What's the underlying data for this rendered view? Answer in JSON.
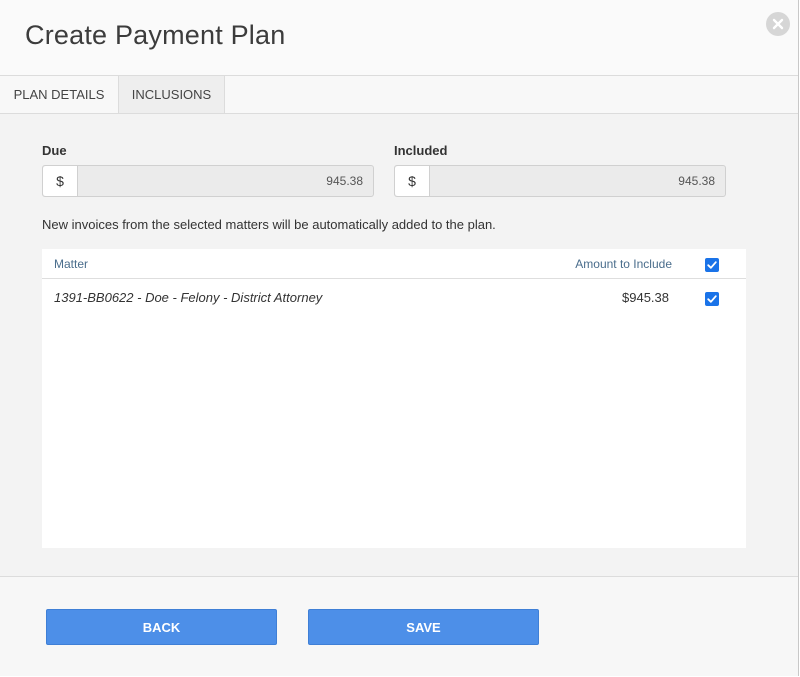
{
  "dialog": {
    "title": "Create Payment Plan"
  },
  "tabs": [
    {
      "label": "PLAN DETAILS",
      "active": false
    },
    {
      "label": "INCLUSIONS",
      "active": true
    }
  ],
  "due": {
    "label": "Due",
    "currency": "$",
    "value": "945.38"
  },
  "included": {
    "label": "Included",
    "currency": "$",
    "value": "945.38"
  },
  "note": "New invoices from the selected matters will be automatically added to the plan.",
  "table": {
    "columns": {
      "matter": "Matter",
      "amount": "Amount to Include"
    },
    "select_all_checked": true,
    "rows": [
      {
        "matter": "1391-BB0622 - Doe - Felony - District Attorney",
        "amount": "$945.38",
        "checked": true
      }
    ]
  },
  "footer": {
    "back_label": "BACK",
    "save_label": "SAVE"
  },
  "colors": {
    "primary_button": "#4d8fe8",
    "checkbox": "#1a73e8"
  },
  "icons": {
    "close": "close-icon",
    "check": "checkmark-icon"
  }
}
